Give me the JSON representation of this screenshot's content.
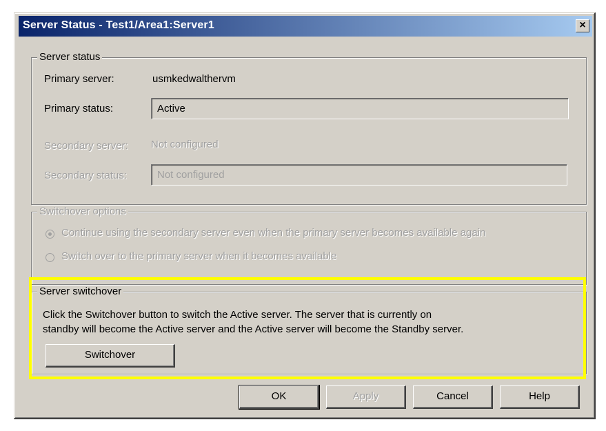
{
  "window": {
    "title": "Server Status - Test1/Area1:Server1",
    "close_glyph": "×"
  },
  "server_status": {
    "legend": "Server status",
    "primary_server_label": "Primary server:",
    "primary_server_value": "usmkedwalthervm",
    "primary_status_label": "Primary status:",
    "primary_status_value": "Active",
    "secondary_server_label": "Secondary server:",
    "secondary_server_value": "Not configured",
    "secondary_status_label": "Secondary status:",
    "secondary_status_value": "Not configured"
  },
  "switchover_options": {
    "legend": "Switchover options",
    "option_continue": "Continue using the secondary server even when the primary server becomes available again",
    "option_switch": "Switch over to the primary server when it becomes available",
    "selected": "option_continue"
  },
  "server_switchover": {
    "legend": "Server switchover",
    "description_line1": "Click the Switchover button to switch the Active server.  The server that is currently on",
    "description_line2": "standby will become the Active server and the Active server will become the Standby server.",
    "button_label": "Switchover",
    "highlight_color": "#ffff00"
  },
  "buttons": {
    "ok": "OK",
    "apply": "Apply",
    "cancel": "Cancel",
    "help": "Help"
  },
  "colors": {
    "dialog_bg": "#d4d0c8",
    "title_gradient_start": "#0a246a",
    "title_gradient_end": "#a6caf0",
    "disabled_text": "#a0a0a0"
  }
}
